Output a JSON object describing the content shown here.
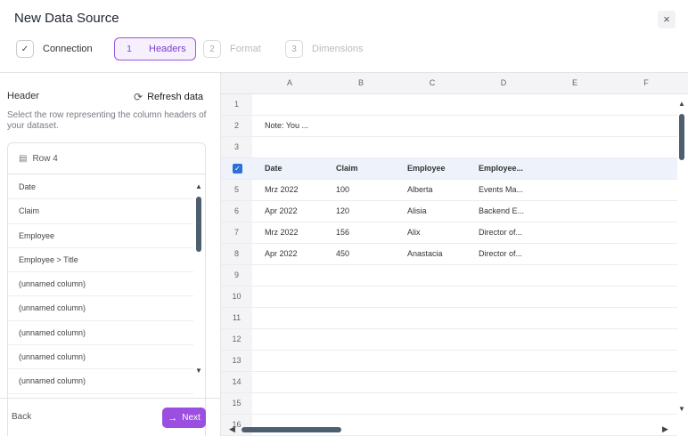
{
  "dialog": {
    "title": "New Data Source",
    "close_label": "×"
  },
  "stepper": {
    "steps": [
      {
        "number": "✓",
        "label": "Connection",
        "state": "done"
      },
      {
        "number": "1",
        "label": "Headers",
        "state": "active"
      },
      {
        "number": "2",
        "label": "Format",
        "state": "todo"
      },
      {
        "number": "3",
        "label": "Dimensions",
        "state": "todo"
      }
    ]
  },
  "left_panel": {
    "header_label": "Header",
    "refresh_label": "Refresh data",
    "refresh_icon": "refresh-icon",
    "help_text": "Select the row representing the column headers of your dataset.",
    "row_selector": "Row 4",
    "columns": [
      "Date",
      "Claim",
      "Employee",
      "Employee > Title",
      "(unnamed column)",
      "(unnamed column)",
      "(unnamed column)",
      "(unnamed column)",
      "(unnamed column)"
    ]
  },
  "footer": {
    "back_label": "Back",
    "next_label": "Next"
  },
  "grid": {
    "column_letters": [
      "A",
      "B",
      "C",
      "D",
      "E",
      "F"
    ],
    "rows": [
      {
        "num": "1",
        "cells": [
          "",
          "",
          "",
          ""
        ]
      },
      {
        "num": "2",
        "cells": [
          "Note: You ...",
          "",
          "",
          ""
        ]
      },
      {
        "num": "3",
        "cells": [
          "",
          "",
          "",
          ""
        ]
      },
      {
        "num": "",
        "checked": true,
        "cells": [
          "Date",
          "Claim",
          "Employee",
          "Employee..."
        ]
      },
      {
        "num": "5",
        "cells": [
          "Mrz 2022",
          "100",
          "Alberta",
          "Events Ma..."
        ]
      },
      {
        "num": "6",
        "cells": [
          "Apr 2022",
          "120",
          "Alisia",
          "Backend E..."
        ]
      },
      {
        "num": "7",
        "cells": [
          "Mrz 2022",
          "156",
          "Alix",
          "Director of..."
        ]
      },
      {
        "num": "8",
        "cells": [
          "Apr 2022",
          "450",
          "Anastacia",
          "Director of..."
        ]
      },
      {
        "num": "9",
        "cells": [
          "",
          "",
          "",
          ""
        ]
      },
      {
        "num": "10",
        "cells": [
          "",
          "",
          "",
          ""
        ]
      },
      {
        "num": "11",
        "cells": [
          "",
          "",
          "",
          ""
        ]
      },
      {
        "num": "12",
        "cells": [
          "",
          "",
          "",
          ""
        ]
      },
      {
        "num": "13",
        "cells": [
          "",
          "",
          "",
          ""
        ]
      },
      {
        "num": "14",
        "cells": [
          "",
          "",
          "",
          ""
        ]
      },
      {
        "num": "15",
        "cells": [
          "",
          "",
          "",
          ""
        ]
      },
      {
        "num": "16",
        "cells": [
          "",
          "",
          "",
          ""
        ]
      }
    ]
  },
  "colors": {
    "accent": "#9b4fe0",
    "checkbox": "#2d6fd6",
    "scroll_thumb": "#4d5e6e"
  }
}
